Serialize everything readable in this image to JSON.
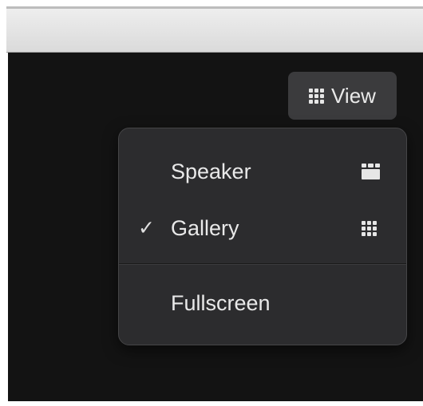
{
  "toolbar": {
    "view_label": "View",
    "view_icon": "grid-icon"
  },
  "view_menu": {
    "items": [
      {
        "label": "Speaker",
        "checked": false,
        "icon": "speaker-view-icon"
      },
      {
        "label": "Gallery",
        "checked": true,
        "check_glyph": "✓",
        "icon": "gallery-view-icon"
      },
      {
        "label": "Fullscreen",
        "checked": false
      }
    ]
  },
  "colors": {
    "background": "#131313",
    "menu_background": "#2c2c2e",
    "button_background": "#3b3b3d",
    "text": "#e9e9e9"
  }
}
